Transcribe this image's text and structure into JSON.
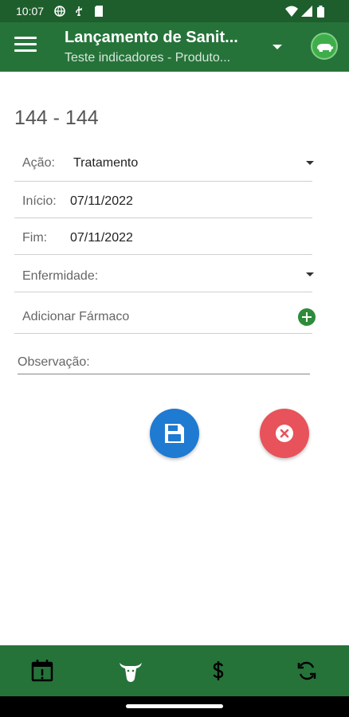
{
  "status_bar": {
    "time": "10:07"
  },
  "app_bar": {
    "title": "Lançamento de Sanit...",
    "subtitle": "Teste indicadores - Produto..."
  },
  "animal": {
    "header": "144 - 144"
  },
  "form": {
    "acao": {
      "label": "Ação:",
      "value": "Tratamento"
    },
    "inicio": {
      "label": "Início:",
      "value": "07/11/2022"
    },
    "fim": {
      "label": "Fim:",
      "value": "07/11/2022"
    },
    "enfermidade": {
      "label": "Enfermidade:",
      "value": ""
    },
    "farmaco": {
      "label": "Adicionar Fármaco"
    },
    "observacao": {
      "label": "Observação:"
    }
  },
  "actions": {
    "save_icon": "floppy-disk-icon",
    "cancel_icon": "close-circle-icon"
  },
  "bottom_nav": {
    "items": [
      {
        "icon": "calendar-alert-icon"
      },
      {
        "icon": "cow-head-icon"
      },
      {
        "icon": "dollar-icon"
      },
      {
        "icon": "sync-icon"
      }
    ]
  },
  "colors": {
    "status_bar": "#1e5e2c",
    "app_bar": "#26733a",
    "save": "#1f7ad2",
    "cancel": "#e8525a",
    "add": "#2e8b3a"
  }
}
